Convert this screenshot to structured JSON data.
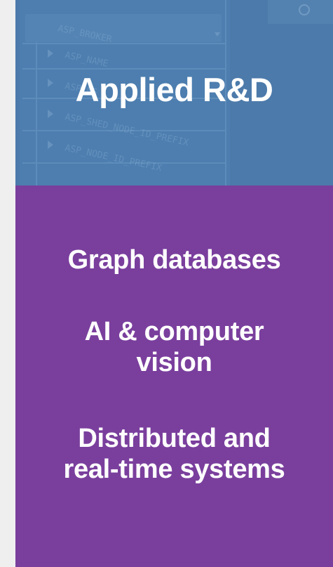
{
  "colors": {
    "page_background": "#efefef",
    "header_background": "#4a78a8",
    "body_background": "#7a3f9d",
    "text": "#ffffff"
  },
  "header": {
    "title": "Applied R&D",
    "background_image": "code-editor-screenshot"
  },
  "capabilities": [
    {
      "lines": [
        "Graph databases"
      ]
    },
    {
      "lines": [
        "AI & computer",
        "vision"
      ]
    },
    {
      "lines": [
        "Distributed and",
        "real-time systems"
      ]
    }
  ]
}
